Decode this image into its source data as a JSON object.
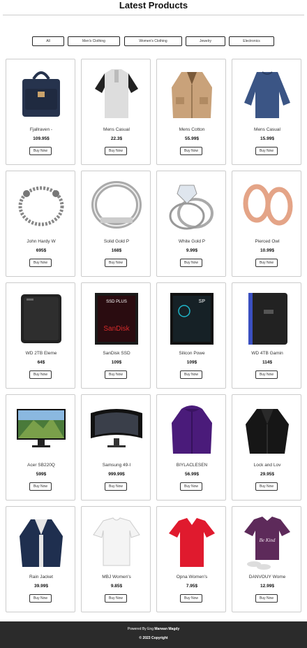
{
  "header": {
    "title": "Latest Products"
  },
  "filters": [
    "All",
    "Men's Clothing",
    "Women's Clothing",
    "Jewelry",
    "Electronics"
  ],
  "buy_label": "Buy Now",
  "products": [
    {
      "name": "Fjallraven -",
      "price": "109.95$",
      "icon": "backpack-image"
    },
    {
      "name": "Mens Casual",
      "price": "22.3$",
      "icon": "raglan-tshirt-image"
    },
    {
      "name": "Mens Cotton",
      "price": "55.99$",
      "icon": "cotton-jacket-image"
    },
    {
      "name": "Mens Casual",
      "price": "15.99$",
      "icon": "slim-fit-shirt-image"
    },
    {
      "name": "John Hardy W",
      "price": "695$",
      "icon": "chain-bracelet-image"
    },
    {
      "name": "Solid Gold P",
      "price": "168$",
      "icon": "silver-ring-image"
    },
    {
      "name": "White Gold P",
      "price": "9.99$",
      "icon": "diamond-ring-image"
    },
    {
      "name": "Pierced Owl",
      "price": "10.99$",
      "icon": "rose-gold-plugs-image"
    },
    {
      "name": "WD 2TB Eleme",
      "price": "64$",
      "icon": "external-drive-image"
    },
    {
      "name": "SanDisk SSD",
      "price": "109$",
      "icon": "sandisk-ssd-image"
    },
    {
      "name": "Silicon Powe",
      "price": "109$",
      "icon": "silicon-power-ssd-image"
    },
    {
      "name": "WD 4TB Gamin",
      "price": "114$",
      "icon": "gaming-drive-image"
    },
    {
      "name": "Acer SB220Q",
      "price": "599$",
      "icon": "monitor-image"
    },
    {
      "name": "Samsung 49-I",
      "price": "999.99$",
      "icon": "curved-monitor-image"
    },
    {
      "name": "BIYLACLESEN",
      "price": "56.99$",
      "icon": "purple-jacket-image"
    },
    {
      "name": "Lock and Lov",
      "price": "29.95$",
      "icon": "leather-jacket-image"
    },
    {
      "name": "Rain Jacket",
      "price": "39.99$",
      "icon": "rain-jacket-image"
    },
    {
      "name": "MBJ Women's",
      "price": "9.85$",
      "icon": "white-top-image"
    },
    {
      "name": "Opna Women's",
      "price": "7.95$",
      "icon": "red-tshirt-image"
    },
    {
      "name": "DANVOUY Wome",
      "price": "12.99$",
      "icon": "purple-tshirt-image"
    }
  ],
  "footer": {
    "prefix": "Powered By Eng",
    "author": "Marwan Magdy",
    "copyright": "© 2023 Copyright"
  }
}
